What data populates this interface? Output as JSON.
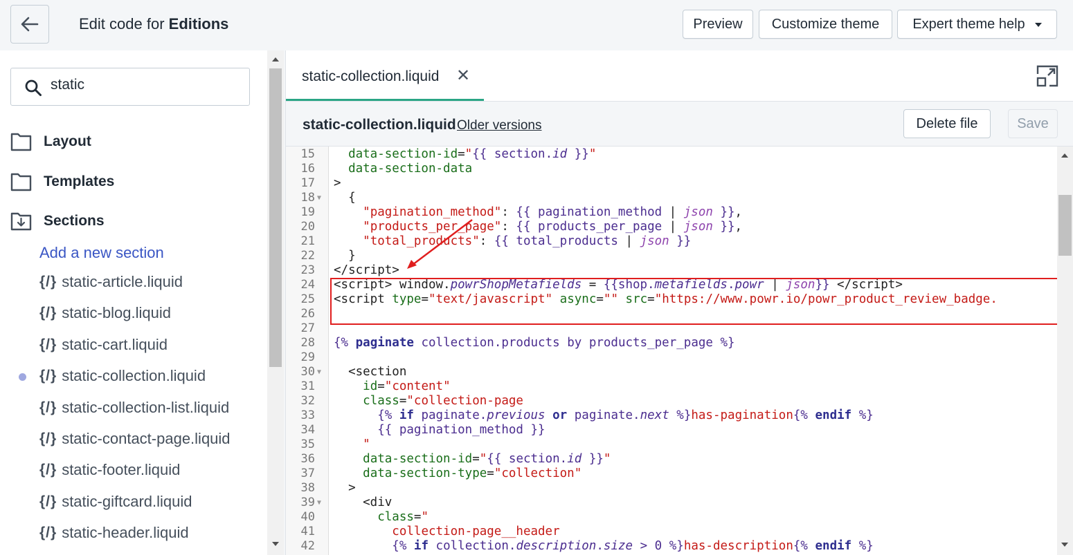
{
  "header": {
    "title_prefix": "Edit code for ",
    "title_theme": "Editions",
    "preview_label": "Preview",
    "customize_label": "Customize theme",
    "help_label": "Expert theme help"
  },
  "sidebar": {
    "search_value": "static",
    "folders": [
      "Layout",
      "Templates",
      "Sections"
    ],
    "add_section_label": "Add a new section",
    "file_icon": "{/}",
    "files": [
      "static-article.liquid",
      "static-blog.liquid",
      "static-cart.liquid",
      "static-collection.liquid",
      "static-collection-list.liquid",
      "static-contact-page.liquid",
      "static-footer.liquid",
      "static-giftcard.liquid",
      "static-header.liquid"
    ],
    "active_file": "static-collection.liquid"
  },
  "editor": {
    "tab_label": "static-collection.liquid",
    "tab_close": "✕",
    "file_name": "static-collection.liquid",
    "older_versions_label": "Older versions",
    "delete_label": "Delete file",
    "save_label": "Save",
    "line_numbers": [
      "15",
      "16",
      "17",
      "18",
      "19",
      "20",
      "21",
      "22",
      "23",
      "24",
      "25",
      "26",
      "27",
      "28",
      "29",
      "30",
      "31",
      "32",
      "33",
      "34",
      "35",
      "36",
      "37",
      "38",
      "39",
      "40",
      "41",
      "42"
    ],
    "accent_color": "#2aa585",
    "highlight_color": "#e01e1e"
  }
}
